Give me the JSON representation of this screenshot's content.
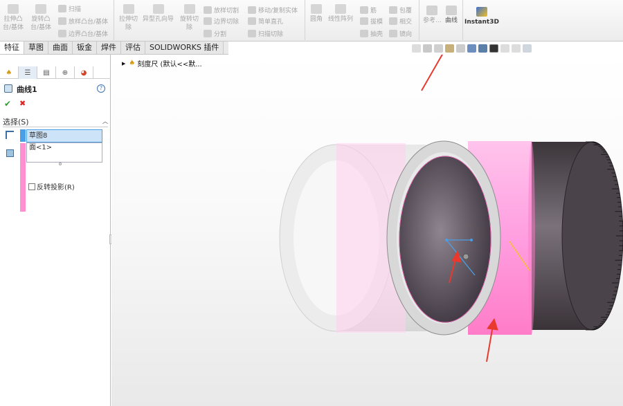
{
  "ribbon": {
    "extrude_boss": "拉伸凸\n台/基体",
    "revolve_boss": "旋转凸\n台/基体",
    "sweep": "扫描",
    "loft_boss": "放样凸台/基体",
    "boundary_boss": "边界凸台/基体",
    "extrude_cut": "拉伸切\n除",
    "hole_wizard": "异型孔向导",
    "revolve_cut": "旋转切\n除",
    "loft_cut": "放样切割",
    "boundary_cut": "边界切除",
    "split": "分割",
    "move_copy": "移动/复制实体",
    "simple_hole": "简单直孔",
    "swept_cut": "扫描切除",
    "fillet": "圆角",
    "linear_pattern": "线性阵列",
    "rib": "筋",
    "draft": "拔模",
    "shell": "抽壳",
    "wrap": "包覆",
    "intersect": "相交",
    "mirror": "镜向",
    "reference": "参考...",
    "curves": "曲线",
    "instant3d": "Instant3D"
  },
  "tabs": [
    "特征",
    "草图",
    "曲面",
    "钣金",
    "焊件",
    "评估",
    "SOLIDWORKS 插件"
  ],
  "property_manager": {
    "title": "曲线1",
    "help": "?",
    "ok": "✔",
    "cancel": "✖",
    "section": "选择(S)",
    "sketch_item": "草图8",
    "face_item": "面<1>",
    "reverse_label": "反转投影(R)"
  },
  "tree": {
    "root_label": "刻度尺 (默认<<默..."
  },
  "colors": {
    "accent_blue": "#4b9fe6",
    "face_pink": "#ff8fd0",
    "arrow_red": "#e8392c"
  }
}
